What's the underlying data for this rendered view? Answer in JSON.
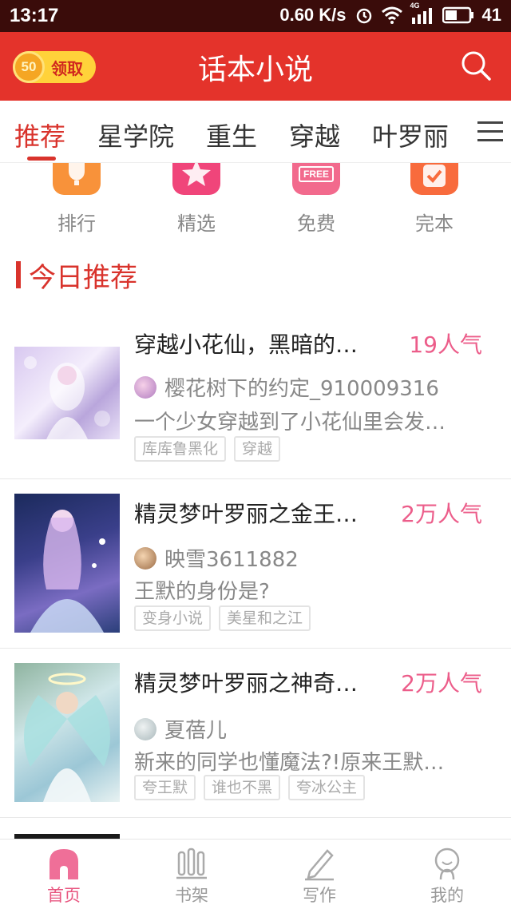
{
  "status_bar": {
    "time": "13:17",
    "net_speed": "0.60 K/s",
    "network_type": "4G",
    "battery": "41"
  },
  "header": {
    "coin_amount": "50",
    "claim_label": "领取",
    "title": "话本小说"
  },
  "tabs": [
    "推荐",
    "星学院",
    "重生",
    "穿越",
    "叶罗丽"
  ],
  "categories": [
    {
      "label": "排行",
      "icon": "trophy-icon",
      "color": "#f8923a"
    },
    {
      "label": "精选",
      "icon": "star-icon",
      "color": "#f0457a"
    },
    {
      "label": "免费",
      "icon": "free-icon",
      "icon_text": "FREE",
      "color": "#f26a8d"
    },
    {
      "label": "完本",
      "icon": "check-icon",
      "color": "#f86b3d"
    }
  ],
  "section_title": "今日推荐",
  "books": [
    {
      "title": "穿越小花仙，黑暗的…",
      "popularity": "19人气",
      "author": "樱花树下的约定_910009316",
      "desc": "一个少女穿越到了小花仙里会发…",
      "tags": [
        "库库鲁黑化",
        "穿越"
      ]
    },
    {
      "title": "精灵梦叶罗丽之金王…",
      "popularity": "2万人气",
      "author": "映雪3611882",
      "desc": "王默的身份是?",
      "tags": [
        "变身小说",
        "美星和之江"
      ]
    },
    {
      "title": "精灵梦叶罗丽之神奇…",
      "popularity": "2万人气",
      "author": "夏蓓儿",
      "desc": "新来的同学也懂魔法?!原来王默…",
      "tags": [
        "夸王默",
        "谁也不黑",
        "夸冰公主"
      ]
    }
  ],
  "bottom_nav": [
    {
      "label": "首页",
      "icon": "home-icon",
      "active": true
    },
    {
      "label": "书架",
      "icon": "bookshelf-icon",
      "active": false
    },
    {
      "label": "写作",
      "icon": "pen-icon",
      "active": false
    },
    {
      "label": "我的",
      "icon": "profile-icon",
      "active": false
    }
  ],
  "colors": {
    "brand_red": "#e4332b",
    "accent_pink": "#ec5d8a",
    "status_bar": "#3a0c0a"
  }
}
